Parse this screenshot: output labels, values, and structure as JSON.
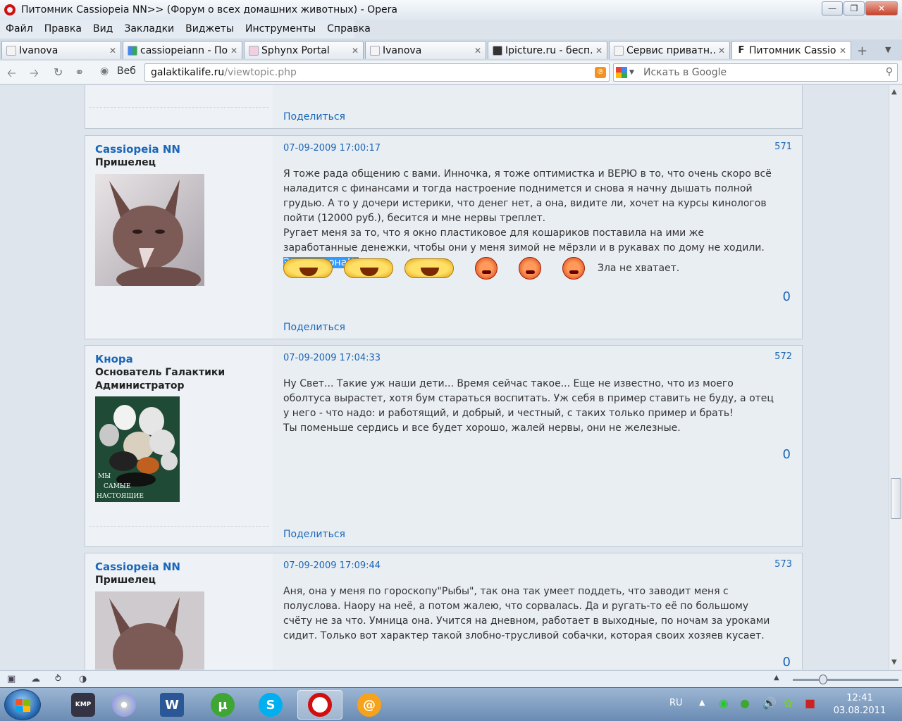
{
  "window": {
    "title": "Питомник Cassiopeia NN>> (Форум о всех домашних животных) - Opera"
  },
  "menu": [
    "Файл",
    "Правка",
    "Вид",
    "Закладки",
    "Виджеты",
    "Инструменты",
    "Справка"
  ],
  "tabs": [
    {
      "label": "Ivanova"
    },
    {
      "label": "cassiopeiann - По..."
    },
    {
      "label": "Sphynx Portal"
    },
    {
      "label": "Ivanova"
    },
    {
      "label": "Ipicture.ru - бесп..."
    },
    {
      "label": "Сервис приватн..."
    },
    {
      "label": "Питомник Cassio..."
    }
  ],
  "address": {
    "web_label": "Веб",
    "url_host": "galaktikalife.ru",
    "url_path": "/viewtopic.php",
    "search_placeholder": "Искать в Google"
  },
  "posts": [
    {
      "share": "Поделиться"
    },
    {
      "author": "Cassiopeia NN",
      "rank": "Пришелец",
      "date": "07-09-2009 17:00:17",
      "number": "571",
      "body_1": "Я тоже рада общению с вами. Инночка, я тоже оптимистка и ВЕРЮ в то, что очень скоро всё наладится с финансами и тогда настроение поднимется и снова я начну дышать полной грудью. А то у дочери истерики, что денег нет, а она, видите ли, хочет на курсы кинологов пойти (12000 руб.), бесится и мне нервы треплет.",
      "body_2": "Ругает меня за то, что я окно пластиковое для кошариков поставила на ими же заработанные денежки, чтобы они у меня зимой не мёрзли и в рукавах по дому не ходили. ",
      "highlight": "Эгоиска она!!!",
      "smiley_text": "Зла не хватает.",
      "rating": "0",
      "share": "Поделиться"
    },
    {
      "author": "Кнора",
      "rank": "Основатель Галактики",
      "rank2": "Администратор",
      "avatar_text_1": "МЫ",
      "avatar_text_2": "САМЫЕ",
      "avatar_text_3": "НАСТОЯЩИЕ",
      "date": "07-09-2009 17:04:33",
      "number": "572",
      "body_1": "Ну Свет... Такие уж наши дети... Время сейчас такое... Еще не известно, что из моего оболтуса вырастет, хотя бум стараться воспитать. Уж себя в пример ставить не буду, а отец у него - что надо: и работящий, и добрый, и честный, с таких только пример и брать!",
      "body_2": "Ты поменьше сердись и все будет хорошо, жалей нервы, они не железные.",
      "rating": "0",
      "share": "Поделиться"
    },
    {
      "author": "Cassiopeia NN",
      "rank": "Пришелец",
      "date": "07-09-2009 17:09:44",
      "number": "573",
      "body_1": "Аня, она у меня по гороскопу\"Рыбы\", так она так умеет поддеть, что заводит меня с полуслова. Наору на неё, а потом жалею, что сорвалась. Да и ругать-то её по большому счёту не за что. Умница она. Учится на дневном, работает в выходные, по ночам за уроками сидит. Только вот характер такой злобно-трусливой собачки, которая своих хозяев кусает.",
      "rating": "0"
    }
  ],
  "taskbar": {
    "kmp_label": "KMP",
    "lang": "RU",
    "time": "12:41",
    "date": "03.08.2011"
  },
  "colors": {
    "link": "#1a66b8",
    "post_bg": "#e9eef3",
    "highlight": "#3399ff"
  }
}
